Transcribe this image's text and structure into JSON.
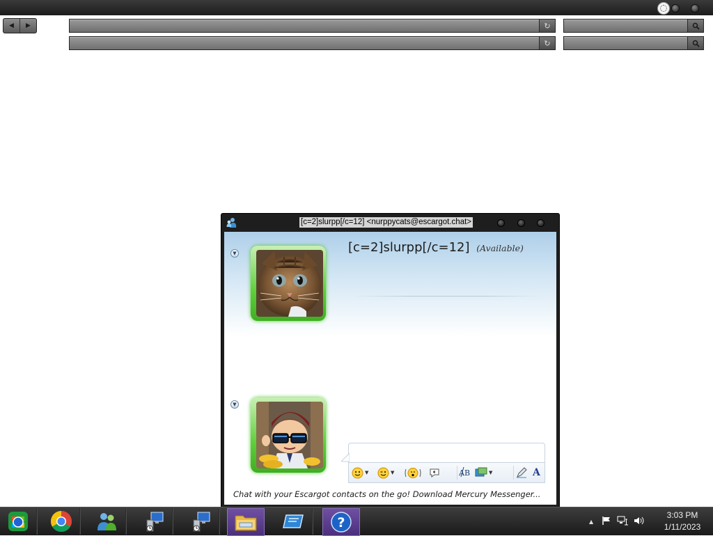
{
  "browser": {
    "back_glyph": "◀",
    "forward_glyph": "▶",
    "address_bars": [
      {
        "value": "",
        "reload_icon": "↻"
      },
      {
        "value": "",
        "reload_icon": "↻"
      }
    ],
    "search_bars": [
      {
        "value": "",
        "search_icon": "search-icon"
      },
      {
        "value": "",
        "search_icon": "search-icon"
      }
    ]
  },
  "chat_window": {
    "title": "[c=2]slurpp[/c=12] <nurppycats@escargot.chat>",
    "contact": {
      "name": "[c=2]slurpp[/c=12]",
      "status": "(Available)",
      "avatar": "kitten-photo"
    },
    "self": {
      "avatar": "cartoon-character-with-sunglasses"
    },
    "message_input": {
      "value": ""
    },
    "toolbar": {
      "emoticons": "emoticon-icon",
      "winks": "wink-icon",
      "nudge": "nudge-icon",
      "voice_clip": "voice-clip-icon",
      "spellcheck": "spellcheck-icon",
      "background": "background-icon",
      "handwriting": "pen-icon",
      "font": "A"
    },
    "promo_text": "Chat with your Escargot contacts on the go! Download Mercury Messenger..."
  },
  "taskbar": {
    "apps": [
      {
        "name": "start-orb"
      },
      {
        "name": "chrome"
      },
      {
        "name": "messenger"
      },
      {
        "name": "remote-desktop-1"
      },
      {
        "name": "remote-desktop-2"
      },
      {
        "name": "file-explorer"
      },
      {
        "name": "window-switcher"
      },
      {
        "name": "help"
      }
    ],
    "help_glyph": "?",
    "tray": {
      "show_hidden": "▲"
    },
    "clock": {
      "time": "3:03 PM",
      "date": "1/11/2023"
    }
  },
  "colors": {
    "avatar_frame": "#5fcf3c",
    "taskbar_active": "#6f4fa2",
    "chat_gradient_top": "#aecfe9"
  }
}
